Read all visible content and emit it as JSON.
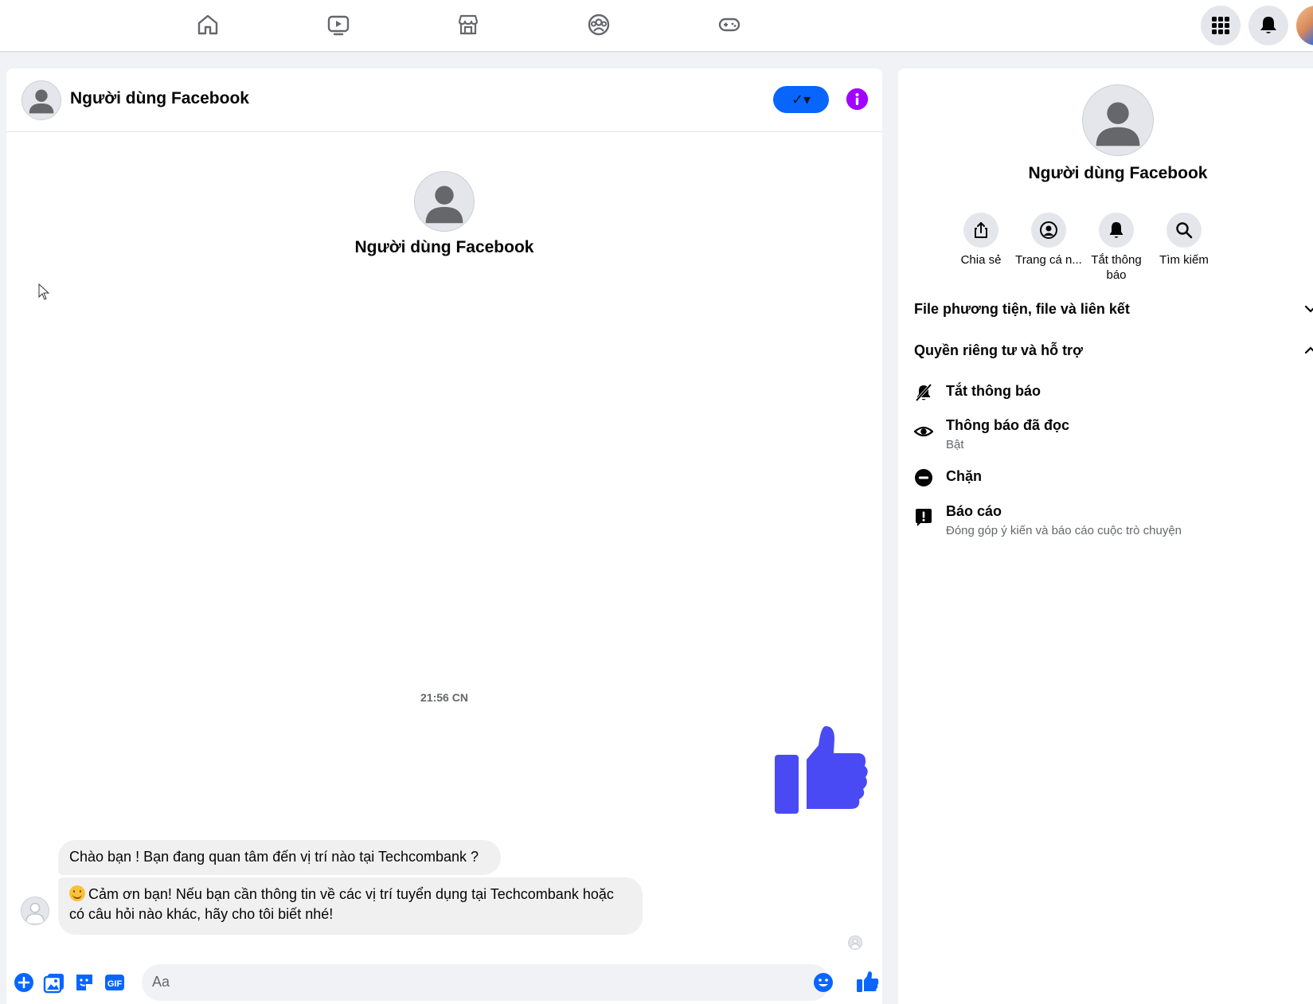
{
  "top_nav": {
    "icons": [
      "home-icon",
      "watch-icon",
      "marketplace-icon",
      "groups-icon",
      "gaming-icon"
    ],
    "right": [
      "menu-grid-icon",
      "notifications-bell-icon",
      "profile-avatar"
    ]
  },
  "chat": {
    "contact_name": "Người dùng Facebook",
    "header_name": "Người dùng Facebook",
    "check_label": "✓▾",
    "timestamp": "21:56 CN",
    "messages": [
      {
        "from": "contact",
        "text": "Chào bạn ! Bạn đang quan tâm đến vị trí nào tại Techcombank ?"
      },
      {
        "from": "contact",
        "emoji": "smiling-face-emoji",
        "text": "Cảm ơn bạn! Nếu bạn cần thông tin về các vị trí tuyển dụng tại Techcombank hoặc có câu hỏi nào khác, hãy cho tôi biết nhé!"
      }
    ],
    "sent_sticker": "thumbs-up-icon"
  },
  "composer": {
    "placeholder": "Aa",
    "icons": [
      "add-icon",
      "photo-icon",
      "sticker-icon",
      "gif-icon",
      "emoji-icon",
      "like-icon"
    ]
  },
  "info_panel": {
    "name": "Người dùng Facebook",
    "actions": [
      {
        "label": "Chia sẻ",
        "icon": "share-icon"
      },
      {
        "label": "Trang cá n...",
        "icon": "profile-icon"
      },
      {
        "label": "Tắt thông báo",
        "icon": "bell-icon"
      },
      {
        "label": "Tìm kiếm",
        "icon": "search-icon"
      }
    ],
    "sections": [
      {
        "label": "File phương tiện, file và liên kết",
        "expanded": false
      },
      {
        "label": "Quyền riêng tư và hỗ trợ",
        "expanded": true
      }
    ],
    "options": [
      {
        "title": "Tắt thông báo",
        "subtitle": "",
        "icon": "mute-bell-icon"
      },
      {
        "title": "Thông báo đã đọc",
        "subtitle": "Bật",
        "icon": "eye-icon"
      },
      {
        "title": "Chặn",
        "subtitle": "",
        "icon": "block-icon"
      },
      {
        "title": "Báo cáo",
        "subtitle": "Đóng góp ý kiến và báo cáo cuộc trò chuyện",
        "icon": "report-icon"
      }
    ]
  },
  "colors": {
    "accent": "#0866ff",
    "info": "#a200ff",
    "sticker": "#4a4af4",
    "bubble": "#f0f0f0",
    "secondary_text": "#65676b"
  }
}
